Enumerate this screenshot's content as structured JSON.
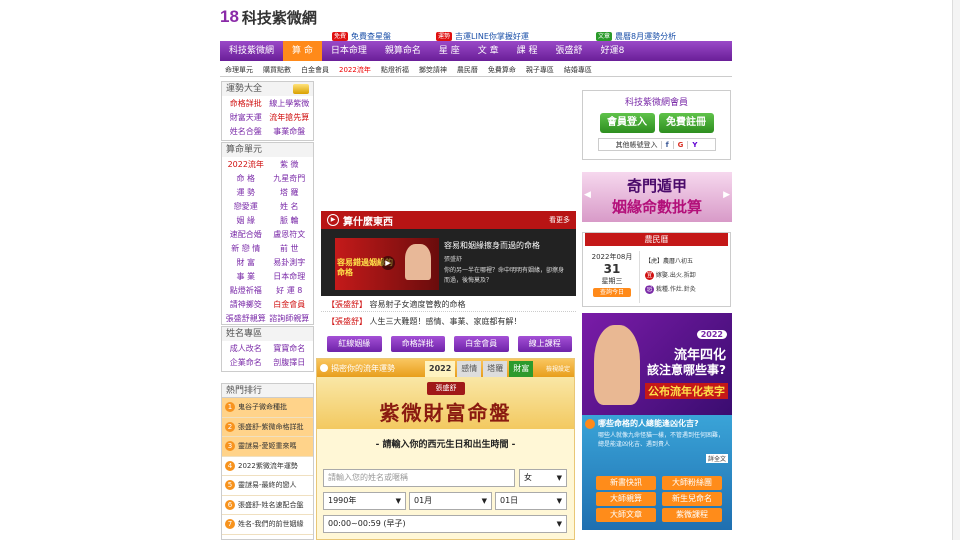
{
  "logo": {
    "mark": "18",
    "text": "科技紫微網"
  },
  "news": [
    {
      "tag": "免費",
      "tag_color": "#e01010",
      "text": "免費查星盤"
    },
    {
      "tag": "運勢",
      "tag_color": "#e01010",
      "text": "吉運LINE你掌握好運"
    },
    {
      "tag": "文章",
      "tag_color": "#2a9a2a",
      "text": "農曆8月運勢分析"
    }
  ],
  "nav": [
    "科技紫微網",
    "算 命",
    "日本命理",
    "親算命名",
    "星 座",
    "文 章",
    "課 程",
    "張盛舒",
    "好運8"
  ],
  "subnav": [
    "命理單元",
    "購買點數",
    "白金會員",
    "2022流年",
    "點燈祈福",
    "擲筊請神",
    "農民曆",
    "免費算命",
    "親子專區",
    "結婚專區"
  ],
  "fortune_box": {
    "title": "運勢大全",
    "items": [
      "命格詳批",
      "線上學紫微",
      "財富天運",
      "流年搶先算",
      "姓名合盤",
      "事業命盤"
    ]
  },
  "unit_box": {
    "title": "算命單元",
    "items": [
      "2022流年",
      "紫 微",
      "命 格",
      "九星奇門",
      "運 勢",
      "塔 羅",
      "戀愛運",
      "姓 名",
      "姻 緣",
      "脈 輪",
      "速配合婚",
      "盧恩符文",
      "新 戀 情",
      "前 世",
      "財 富",
      "易卦測字",
      "事 業",
      "日本命理",
      "點燈祈福",
      "好 運 8",
      "請神擲筊",
      "白金會員",
      "張盛舒親算",
      "諮詢師親算"
    ]
  },
  "name_box": {
    "title": "姓名專區",
    "items": [
      "成人改名",
      "寶寶命名",
      "企業命名",
      "剖腹擇日"
    ]
  },
  "rank": {
    "title": "熱門排行",
    "items": [
      "鬼谷子微命種批",
      "張盛舒-紫微命格詳批",
      "靈謎易-愛姬重來嗎",
      "2022紫微流年運勢",
      "靈謎易-最終的戀人",
      "張盛舒-姓名速配合盤",
      "姓名-我們的前世姻緣"
    ]
  },
  "video": {
    "title": "算什麼東西",
    "more": "看更多",
    "headline": "容易和姻緣擦身而過的命格",
    "author": "張盛舒",
    "desc": "你的另一半在哪裡？命中明明有姻緣，卻擦身而過，後悔莫及？",
    "thumb_text": "容易錯過姻緣的命格"
  },
  "articles": [
    {
      "tag": "【張盛舒】",
      "text": "容易射子女適度管教的命格"
    },
    {
      "tag": "【張盛舒】",
      "text": "人生三大難題！感情、事業、家庭都有解！"
    }
  ],
  "buttons": [
    "紅線姻緣",
    "命格詳批",
    "白金會員",
    "線上課程"
  ],
  "fortune_panel": {
    "head": "揭密你的流年運勢",
    "tabs": [
      "2022",
      "感情",
      "塔羅",
      "財富"
    ],
    "settings": "檢視設定",
    "banner_small": "張盛舒",
    "banner_big": "紫微財富命盤",
    "prompt": "- 請輸入你的西元生日和出生時間 -",
    "name_placeholder": "請輸入您的姓名或暱稱",
    "gender": "女",
    "year": "1990年",
    "month": "01月",
    "day": "01日",
    "hour": "00:00~00:59 (早子)"
  },
  "member": {
    "title": "科技紫微網會員",
    "login": "會員登入",
    "register": "免費註冊",
    "other": "其他帳號登入",
    "fb": "f",
    "g": "G",
    "y": "Y"
  },
  "qimen": {
    "line1": "奇門遁甲",
    "line2": "姻緣命數批算"
  },
  "calendar": {
    "title": "農民曆",
    "date": "2022年08月",
    "day": "31",
    "weekday": "星期三",
    "btn": "查詢今日",
    "line1": "【虎】農曆八初五",
    "good": "嫁娶.出火.拆卸",
    "bad": "栽種.作灶.針灸"
  },
  "ad": {
    "badge": "2022",
    "line1": "流年四化",
    "line2": "該注意哪些事?",
    "line3": "公布流年化表字"
  },
  "quiz": {
    "title": "哪些命格的人總能逢凶化吉?",
    "desc": "哪些人就像九命怪貓一樣，不管遇到任何困難，總是能逢凶化吉、遇到貴人",
    "more": "詳全文",
    "buttons": [
      "新書快訊",
      "大師粉絲團",
      "大師親算",
      "新生兒命名",
      "大師文章",
      "紫微課程"
    ]
  },
  "colors": {
    "purple": "#7a2aa8",
    "orange": "#ff8a1a",
    "red": "#b81414",
    "green": "#2d8e1f"
  }
}
